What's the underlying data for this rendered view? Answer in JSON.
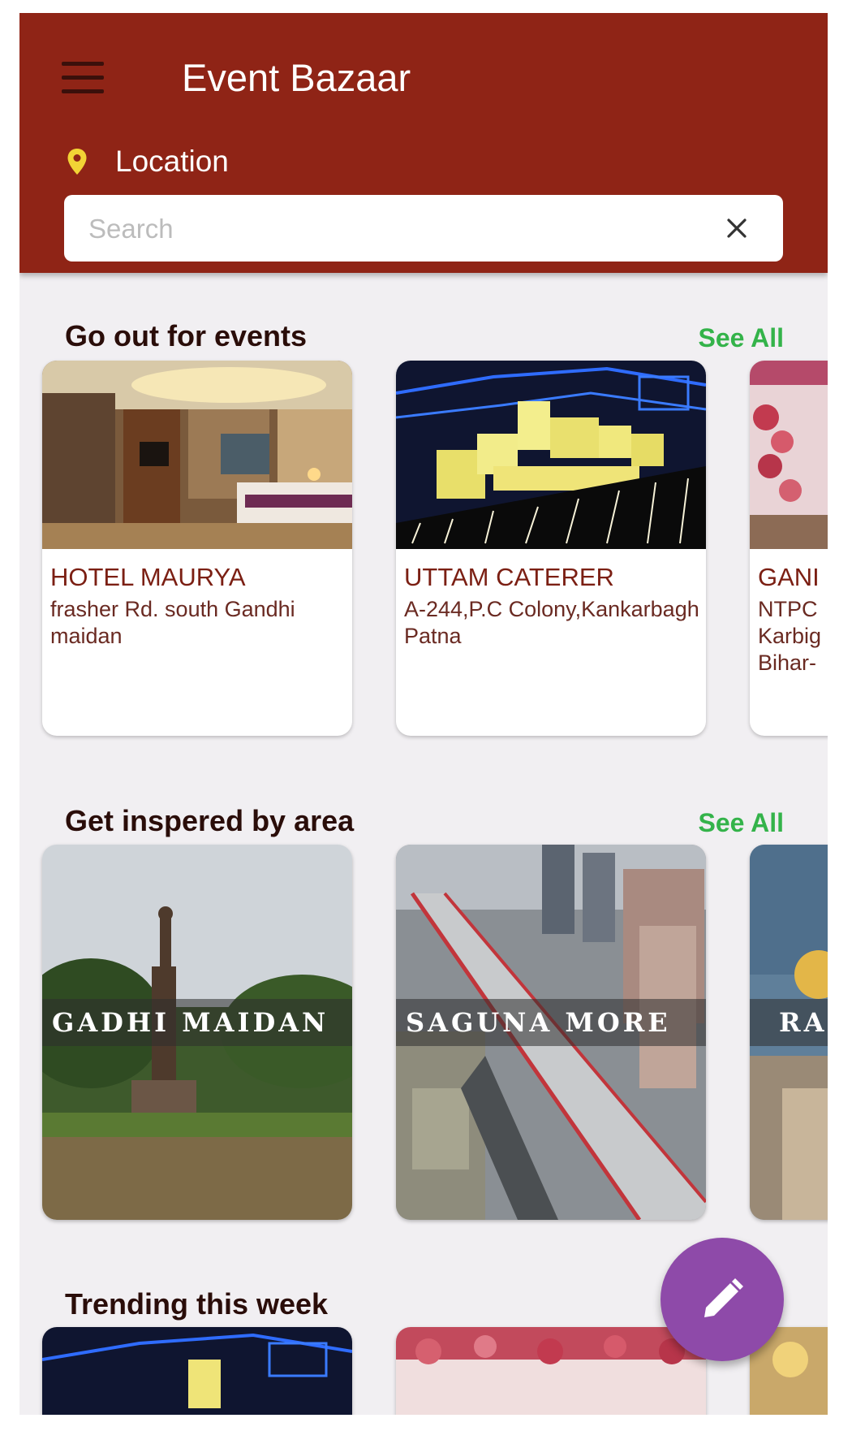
{
  "app_bar": {
    "title": "Event Bazaar",
    "location_label": "Location",
    "search_placeholder": "Search",
    "menu_icon": "hamburger-menu-icon",
    "location_icon": "map-pin-icon",
    "clear_icon": "close-icon"
  },
  "colors": {
    "app_bar": "#8f2416",
    "accent_green": "#34b34a",
    "fab": "#8e4aa9",
    "pin": "#f2d335"
  },
  "sections": {
    "events": {
      "title": "Go out for events",
      "see_all": "See All",
      "cards": [
        {
          "name": "HOTEL MAURYA",
          "address": "frasher Rd. south Gandhi maidan"
        },
        {
          "name": "UTTAM CATERER",
          "address": "A-244,P.C Colony,Kankarbagh Patna"
        },
        {
          "name": "GANI",
          "address": "NTPC Karbig Bihar-"
        }
      ]
    },
    "areas": {
      "title": "Get inspered by area",
      "see_all": "See All",
      "cards": [
        {
          "label": "GADHI MAIDAN"
        },
        {
          "label": "SAGUNA MORE"
        },
        {
          "label": "RA"
        }
      ]
    },
    "trending": {
      "title": "Trending this week"
    }
  },
  "fab": {
    "icon": "pencil-edit-icon"
  }
}
